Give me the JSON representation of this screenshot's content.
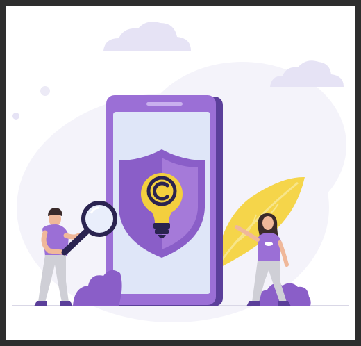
{
  "illustration": {
    "subject": "copyright-protection",
    "icons": [
      "cloud-icon",
      "smartphone-icon",
      "shield-icon",
      "lightbulb-icon",
      "copyright-icon",
      "magnifying-glass-icon"
    ],
    "figures": [
      "man-with-magnifier",
      "woman-pointing"
    ],
    "colors": {
      "frame": "#2e2e2e",
      "background": "#ffffff",
      "blob": "#f4f3fa",
      "cloud": "#e6e3f5",
      "phone_body": "#9b6fd6",
      "phone_dark": "#5b3f9a",
      "phone_screen": "#dfe6f8",
      "shield": "#8a5ec8",
      "shield_inner": "#a57ad9",
      "bulb": "#f3cf3e",
      "bulb_base": "#2a2350",
      "leaf": "#f5d54a",
      "bush": "#8a5ec8",
      "shirt": "#9b6fd6",
      "pants": "#cfcfd6",
      "skin": "#f0b89a",
      "hair": "#3a2a2a"
    }
  }
}
